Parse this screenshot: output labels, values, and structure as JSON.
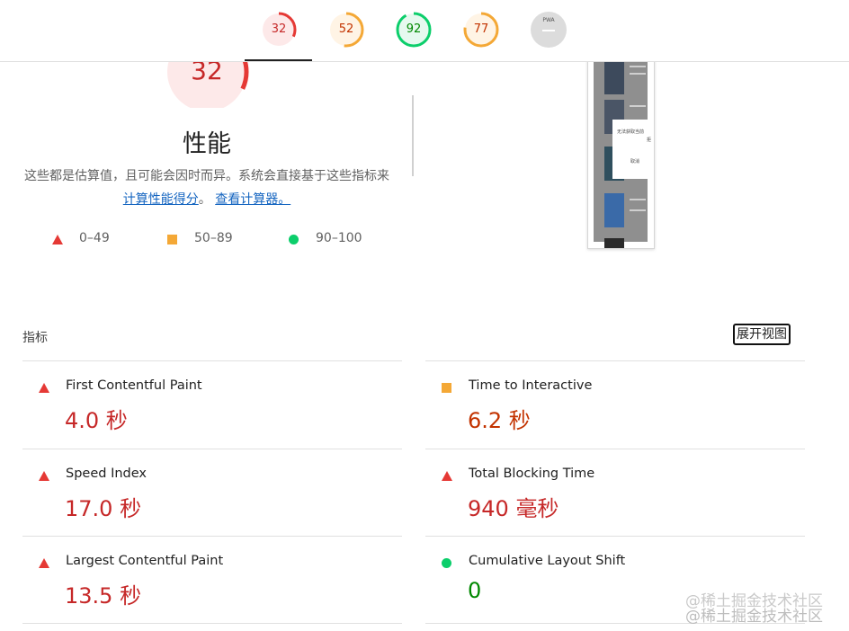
{
  "topbar": {
    "gauges": [
      {
        "score": "32",
        "status": "fail",
        "color": "#e53935",
        "fill": 0.32
      },
      {
        "score": "52",
        "status": "average",
        "color": "#f4a836",
        "fill": 0.52
      },
      {
        "score": "92",
        "status": "pass",
        "color": "#0cce6b",
        "fill": 0.92
      },
      {
        "score": "77",
        "status": "average",
        "color": "#f4a836",
        "fill": 0.77
      }
    ],
    "pwa": {
      "label": "PWA"
    }
  },
  "performance": {
    "score": "32",
    "fill": 0.32,
    "title": "性能",
    "desc_prefix": "这些都是估算值，且可能会因时而异。系统会直接基于这些指标来",
    "link_calc_score": "计算性能得分",
    "desc_sep": "。",
    "link_calculator": "查看计算器。",
    "legend": [
      {
        "range": "0–49",
        "shape": "triangle",
        "color": "#e53935"
      },
      {
        "range": "50–89",
        "shape": "square",
        "color": "#f4a836"
      },
      {
        "range": "90–100",
        "shape": "circle",
        "color": "#0cce6b"
      }
    ]
  },
  "thumbnail": {
    "dialog_text": "无法获取当前",
    "dialog_line2": "拒",
    "dialog_cancel": "取消"
  },
  "metrics": {
    "title": "指标",
    "expand_label": "展开视图",
    "items": [
      {
        "label": "First Contentful Paint",
        "value": "4.0 秒",
        "status": "fail"
      },
      {
        "label": "Time to Interactive",
        "value": "6.2 秒",
        "status": "average"
      },
      {
        "label": "Speed Index",
        "value": "17.0 秒",
        "status": "fail"
      },
      {
        "label": "Total Blocking Time",
        "value": "940 毫秒",
        "status": "fail"
      },
      {
        "label": "Largest Contentful Paint",
        "value": "13.5 秒",
        "status": "fail"
      },
      {
        "label": "Cumulative Layout Shift",
        "value": "0",
        "status": "pass"
      }
    ]
  },
  "watermark": "@稀土掘金技术社区"
}
